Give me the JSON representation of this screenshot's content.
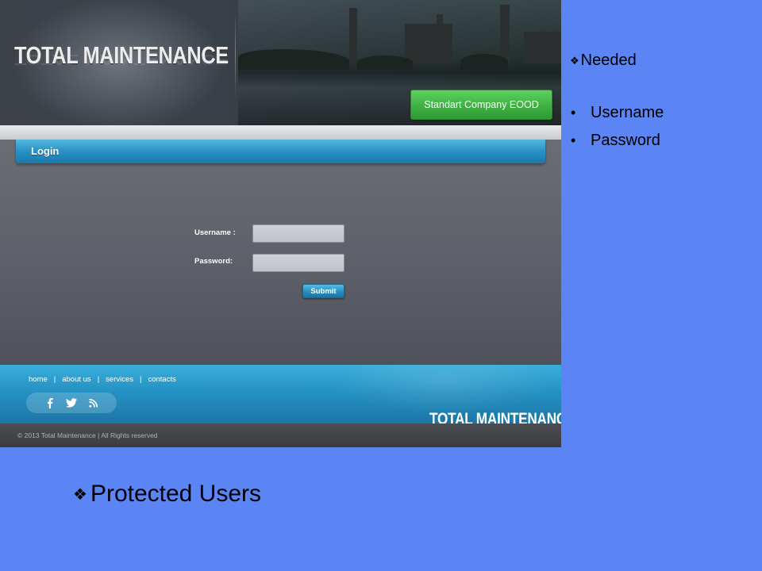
{
  "site": {
    "logo_text": "TOTAL MAINTENANCE",
    "company_button_label": "Standart Company EOOD",
    "login_title": "Login",
    "username_label": "Username :",
    "password_label": "Password:",
    "username_value": "",
    "password_value": "",
    "submit_label": "Submit",
    "footer_nav": [
      "home",
      "about us",
      "services",
      "contacts"
    ],
    "footer_nav_separator": "|",
    "social_icons": [
      "facebook-icon",
      "twitter-icon",
      "rss-icon"
    ],
    "footer_logo_text": "TOTAL MAINTENANCE",
    "copyright": "© 2013 Total Maintenance | All Rights reserved"
  },
  "slide": {
    "needed_heading": "Needed",
    "needed_items": [
      "Username",
      "Password"
    ],
    "bottom_heading": "Protected Users",
    "bullet_glyph": "❖",
    "sub_bullet_glyph": "•",
    "background_color": "#5b84f5"
  }
}
